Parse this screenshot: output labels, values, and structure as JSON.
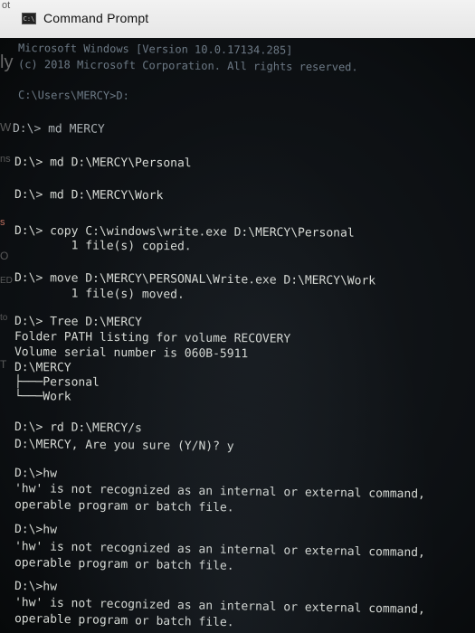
{
  "window": {
    "title": "Command Prompt",
    "icon": "cmd-icon",
    "icon_text": "C:\\"
  },
  "background_fragments": [
    "ot",
    "ly",
    "W",
    "ns",
    "s",
    "O",
    "ED",
    "to",
    "T"
  ],
  "console_lines": [
    "Microsoft Windows [Version 10.0.17134.285]",
    "(c) 2018 Microsoft Corporation. All rights reserved.",
    "C:\\Users\\MERCY>D:",
    "D:\\> md MERCY",
    "D:\\> md D:\\MERCY\\Personal",
    "D:\\> md D:\\MERCY\\Work",
    "D:\\> copy C:\\windows\\write.exe D:\\MERCY\\Personal",
    "        1 file(s) copied.",
    "D:\\> move D:\\MERCY\\PERSONAL\\Write.exe D:\\MERCY\\Work",
    "        1 file(s) moved.",
    "D:\\> Tree D:\\MERCY",
    "Folder PATH listing for volume RECOVERY",
    "Volume serial number is 060B-5911",
    "D:\\MERCY",
    "├───Personal",
    "└───Work",
    "D:\\> rd D:\\MERCY/s",
    "D:\\MERCY, Are you sure (Y/N)? y",
    "D:\\>hw",
    "'hw' is not recognized as an internal or external command,",
    "operable program or batch file.",
    "D:\\>hw",
    "'hw' is not recognized as an internal or external command,",
    "operable program or batch file.",
    "D:\\>hw",
    "'hw' is not recognized as an internal or external command,",
    "operable program or batch file."
  ]
}
